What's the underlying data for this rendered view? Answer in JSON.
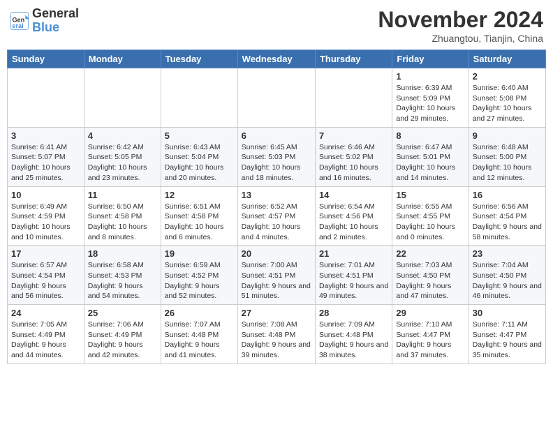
{
  "header": {
    "logo_general": "General",
    "logo_blue": "Blue",
    "month_title": "November 2024",
    "location": "Zhuangtou, Tianjin, China"
  },
  "days_of_week": [
    "Sunday",
    "Monday",
    "Tuesday",
    "Wednesday",
    "Thursday",
    "Friday",
    "Saturday"
  ],
  "weeks": [
    [
      {
        "day": "",
        "info": ""
      },
      {
        "day": "",
        "info": ""
      },
      {
        "day": "",
        "info": ""
      },
      {
        "day": "",
        "info": ""
      },
      {
        "day": "",
        "info": ""
      },
      {
        "day": "1",
        "info": "Sunrise: 6:39 AM\nSunset: 5:09 PM\nDaylight: 10 hours and 29 minutes."
      },
      {
        "day": "2",
        "info": "Sunrise: 6:40 AM\nSunset: 5:08 PM\nDaylight: 10 hours and 27 minutes."
      }
    ],
    [
      {
        "day": "3",
        "info": "Sunrise: 6:41 AM\nSunset: 5:07 PM\nDaylight: 10 hours and 25 minutes."
      },
      {
        "day": "4",
        "info": "Sunrise: 6:42 AM\nSunset: 5:05 PM\nDaylight: 10 hours and 23 minutes."
      },
      {
        "day": "5",
        "info": "Sunrise: 6:43 AM\nSunset: 5:04 PM\nDaylight: 10 hours and 20 minutes."
      },
      {
        "day": "6",
        "info": "Sunrise: 6:45 AM\nSunset: 5:03 PM\nDaylight: 10 hours and 18 minutes."
      },
      {
        "day": "7",
        "info": "Sunrise: 6:46 AM\nSunset: 5:02 PM\nDaylight: 10 hours and 16 minutes."
      },
      {
        "day": "8",
        "info": "Sunrise: 6:47 AM\nSunset: 5:01 PM\nDaylight: 10 hours and 14 minutes."
      },
      {
        "day": "9",
        "info": "Sunrise: 6:48 AM\nSunset: 5:00 PM\nDaylight: 10 hours and 12 minutes."
      }
    ],
    [
      {
        "day": "10",
        "info": "Sunrise: 6:49 AM\nSunset: 4:59 PM\nDaylight: 10 hours and 10 minutes."
      },
      {
        "day": "11",
        "info": "Sunrise: 6:50 AM\nSunset: 4:58 PM\nDaylight: 10 hours and 8 minutes."
      },
      {
        "day": "12",
        "info": "Sunrise: 6:51 AM\nSunset: 4:58 PM\nDaylight: 10 hours and 6 minutes."
      },
      {
        "day": "13",
        "info": "Sunrise: 6:52 AM\nSunset: 4:57 PM\nDaylight: 10 hours and 4 minutes."
      },
      {
        "day": "14",
        "info": "Sunrise: 6:54 AM\nSunset: 4:56 PM\nDaylight: 10 hours and 2 minutes."
      },
      {
        "day": "15",
        "info": "Sunrise: 6:55 AM\nSunset: 4:55 PM\nDaylight: 10 hours and 0 minutes."
      },
      {
        "day": "16",
        "info": "Sunrise: 6:56 AM\nSunset: 4:54 PM\nDaylight: 9 hours and 58 minutes."
      }
    ],
    [
      {
        "day": "17",
        "info": "Sunrise: 6:57 AM\nSunset: 4:54 PM\nDaylight: 9 hours and 56 minutes."
      },
      {
        "day": "18",
        "info": "Sunrise: 6:58 AM\nSunset: 4:53 PM\nDaylight: 9 hours and 54 minutes."
      },
      {
        "day": "19",
        "info": "Sunrise: 6:59 AM\nSunset: 4:52 PM\nDaylight: 9 hours and 52 minutes."
      },
      {
        "day": "20",
        "info": "Sunrise: 7:00 AM\nSunset: 4:51 PM\nDaylight: 9 hours and 51 minutes."
      },
      {
        "day": "21",
        "info": "Sunrise: 7:01 AM\nSunset: 4:51 PM\nDaylight: 9 hours and 49 minutes."
      },
      {
        "day": "22",
        "info": "Sunrise: 7:03 AM\nSunset: 4:50 PM\nDaylight: 9 hours and 47 minutes."
      },
      {
        "day": "23",
        "info": "Sunrise: 7:04 AM\nSunset: 4:50 PM\nDaylight: 9 hours and 46 minutes."
      }
    ],
    [
      {
        "day": "24",
        "info": "Sunrise: 7:05 AM\nSunset: 4:49 PM\nDaylight: 9 hours and 44 minutes."
      },
      {
        "day": "25",
        "info": "Sunrise: 7:06 AM\nSunset: 4:49 PM\nDaylight: 9 hours and 42 minutes."
      },
      {
        "day": "26",
        "info": "Sunrise: 7:07 AM\nSunset: 4:48 PM\nDaylight: 9 hours and 41 minutes."
      },
      {
        "day": "27",
        "info": "Sunrise: 7:08 AM\nSunset: 4:48 PM\nDaylight: 9 hours and 39 minutes."
      },
      {
        "day": "28",
        "info": "Sunrise: 7:09 AM\nSunset: 4:48 PM\nDaylight: 9 hours and 38 minutes."
      },
      {
        "day": "29",
        "info": "Sunrise: 7:10 AM\nSunset: 4:47 PM\nDaylight: 9 hours and 37 minutes."
      },
      {
        "day": "30",
        "info": "Sunrise: 7:11 AM\nSunset: 4:47 PM\nDaylight: 9 hours and 35 minutes."
      }
    ]
  ]
}
